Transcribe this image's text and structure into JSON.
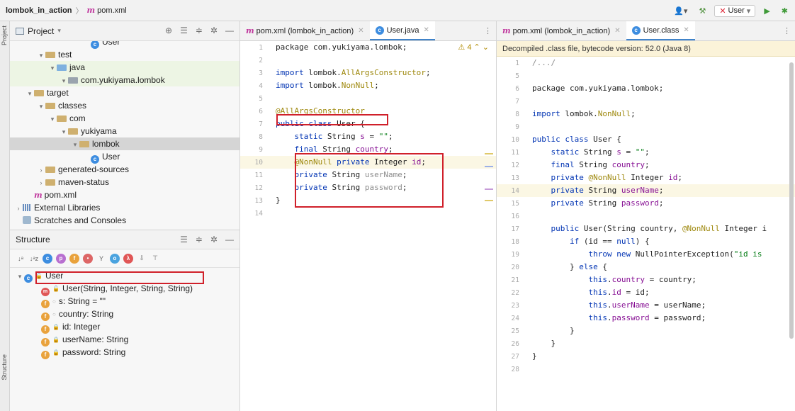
{
  "topbar": {
    "project": "lombok_in_action",
    "file": "pom.xml",
    "run_config": "User"
  },
  "stripe": {
    "top_label": "Project",
    "bottom_label": "Structure"
  },
  "project_panel": {
    "title": "Project",
    "tree": [
      {
        "label": "User",
        "type": "class",
        "indent": 5
      },
      {
        "label": "test",
        "type": "folder",
        "color": "yellow",
        "arrow": "open",
        "indent": 1
      },
      {
        "label": "java",
        "type": "folder",
        "color": "green",
        "arrow": "open",
        "indent": 2,
        "highlight": "green"
      },
      {
        "label": "com.yukiyama.lombok",
        "type": "folder",
        "color": "grey",
        "arrow": "open",
        "indent": 3,
        "highlight": "green"
      },
      {
        "label": "target",
        "type": "folder",
        "color": "yellow",
        "arrow": "open",
        "indent": 0
      },
      {
        "label": "classes",
        "type": "folder",
        "color": "yellow",
        "arrow": "open",
        "indent": 1
      },
      {
        "label": "com",
        "type": "folder",
        "color": "yellow",
        "arrow": "open",
        "indent": 2
      },
      {
        "label": "yukiyama",
        "type": "folder",
        "color": "yellow",
        "arrow": "open",
        "indent": 3
      },
      {
        "label": "lombok",
        "type": "folder",
        "color": "yellow",
        "arrow": "open",
        "indent": 4,
        "highlight": "selected"
      },
      {
        "label": "User",
        "type": "class",
        "indent": 5
      },
      {
        "label": "generated-sources",
        "type": "folder",
        "color": "yellow",
        "arrow": "closed",
        "indent": 1
      },
      {
        "label": "maven-status",
        "type": "folder",
        "color": "yellow",
        "arrow": "closed",
        "indent": 1
      },
      {
        "label": "pom.xml",
        "type": "maven",
        "indent": 0
      },
      {
        "label": "External Libraries",
        "type": "libs",
        "arrow": "closed",
        "indent": -1
      },
      {
        "label": "Scratches and Consoles",
        "type": "scratch",
        "indent": -1
      }
    ]
  },
  "structure_panel": {
    "title": "Structure",
    "root": "User",
    "members": [
      {
        "label": "User(String, Integer, String, String)",
        "kind": "method",
        "vis": "public"
      },
      {
        "label": "s: String = \"\"",
        "kind": "field",
        "vis": "package",
        "static": true
      },
      {
        "label": "country: String",
        "kind": "field",
        "vis": "package"
      },
      {
        "label": "id: Integer",
        "kind": "field",
        "vis": "private"
      },
      {
        "label": "userName: String",
        "kind": "field",
        "vis": "private"
      },
      {
        "label": "password: String",
        "kind": "field",
        "vis": "private"
      }
    ]
  },
  "editor_left": {
    "tabs": [
      {
        "label": "pom.xml (lombok_in_action)",
        "icon": "maven",
        "active": false
      },
      {
        "label": "User.java",
        "icon": "class",
        "active": true
      }
    ],
    "warnings": "4",
    "lines": [
      [
        {
          "t": "package com.yukiyama.lombok;",
          "c": ""
        }
      ],
      [],
      [
        {
          "t": "import ",
          "c": "kw"
        },
        {
          "t": "lombok.",
          "c": ""
        },
        {
          "t": "AllArgsConstructor",
          "c": "ann"
        },
        {
          "t": ";",
          "c": ""
        }
      ],
      [
        {
          "t": "import ",
          "c": "kw"
        },
        {
          "t": "lombok.",
          "c": ""
        },
        {
          "t": "NonNull",
          "c": "ann"
        },
        {
          "t": ";",
          "c": ""
        }
      ],
      [],
      [
        {
          "t": "@AllArgsConstructor",
          "c": "ann"
        }
      ],
      [
        {
          "t": "public class ",
          "c": "kw"
        },
        {
          "t": "User {",
          "c": ""
        }
      ],
      [
        {
          "t": "    ",
          "c": ""
        },
        {
          "t": "static ",
          "c": "kw"
        },
        {
          "t": "String ",
          "c": ""
        },
        {
          "t": "s",
          "c": "fld"
        },
        {
          "t": " = ",
          "c": ""
        },
        {
          "t": "\"\"",
          "c": "str"
        },
        {
          "t": ";",
          "c": ""
        }
      ],
      [
        {
          "t": "    ",
          "c": ""
        },
        {
          "t": "final ",
          "c": "kw"
        },
        {
          "t": "String ",
          "c": ""
        },
        {
          "t": "country",
          "c": "fld"
        },
        {
          "t": ";",
          "c": ""
        }
      ],
      [
        {
          "t": "    ",
          "c": ""
        },
        {
          "t": "@NonNull ",
          "c": "ann"
        },
        {
          "t": "private ",
          "c": "kw"
        },
        {
          "t": "Integer ",
          "c": ""
        },
        {
          "t": "id",
          "c": "fld"
        },
        {
          "t": ";",
          "c": ""
        }
      ],
      [
        {
          "t": "    ",
          "c": ""
        },
        {
          "t": "private ",
          "c": "kw"
        },
        {
          "t": "String ",
          "c": ""
        },
        {
          "t": "userName",
          "c": "grey"
        },
        {
          "t": ";",
          "c": ""
        }
      ],
      [
        {
          "t": "    ",
          "c": ""
        },
        {
          "t": "private ",
          "c": "kw"
        },
        {
          "t": "String ",
          "c": ""
        },
        {
          "t": "password",
          "c": "grey"
        },
        {
          "t": ";",
          "c": ""
        }
      ],
      [
        {
          "t": "}",
          "c": ""
        }
      ],
      []
    ]
  },
  "editor_right": {
    "tabs": [
      {
        "label": "pom.xml (lombok_in_action)",
        "icon": "maven",
        "active": false
      },
      {
        "label": "User.class",
        "icon": "class",
        "active": true
      }
    ],
    "banner": "Decompiled .class file, bytecode version: 52.0 (Java 8)",
    "line_numbers": [
      "1",
      "5",
      "6",
      "7",
      "8",
      "9",
      "10",
      "11",
      "12",
      "13",
      "14",
      "15",
      "16",
      "17",
      "18",
      "19",
      "20",
      "21",
      "22",
      "23",
      "24",
      "25",
      "26",
      "27",
      "28"
    ],
    "lines": [
      [
        {
          "t": "/.../",
          "c": "grey"
        }
      ],
      [],
      [
        {
          "t": "package com.yukiyama.lombok;",
          "c": ""
        }
      ],
      [],
      [
        {
          "t": "import ",
          "c": "kw"
        },
        {
          "t": "lombok.",
          "c": ""
        },
        {
          "t": "NonNull",
          "c": "ann"
        },
        {
          "t": ";",
          "c": ""
        }
      ],
      [],
      [
        {
          "t": "public class ",
          "c": "kw"
        },
        {
          "t": "User {",
          "c": ""
        }
      ],
      [
        {
          "t": "    ",
          "c": ""
        },
        {
          "t": "static ",
          "c": "kw"
        },
        {
          "t": "String ",
          "c": ""
        },
        {
          "t": "s",
          "c": "fld"
        },
        {
          "t": " = ",
          "c": ""
        },
        {
          "t": "\"\"",
          "c": "str"
        },
        {
          "t": ";",
          "c": ""
        }
      ],
      [
        {
          "t": "    ",
          "c": ""
        },
        {
          "t": "final ",
          "c": "kw"
        },
        {
          "t": "String ",
          "c": ""
        },
        {
          "t": "country",
          "c": "fld"
        },
        {
          "t": ";",
          "c": ""
        }
      ],
      [
        {
          "t": "    ",
          "c": ""
        },
        {
          "t": "private ",
          "c": "kw"
        },
        {
          "t": "@NonNull ",
          "c": "ann"
        },
        {
          "t": "Integer ",
          "c": ""
        },
        {
          "t": "id",
          "c": "fld"
        },
        {
          "t": ";",
          "c": ""
        }
      ],
      [
        {
          "t": "    ",
          "c": ""
        },
        {
          "t": "private ",
          "c": "kw"
        },
        {
          "t": "String ",
          "c": ""
        },
        {
          "t": "userName",
          "c": "fld"
        },
        {
          "t": ";",
          "c": ""
        }
      ],
      [
        {
          "t": "    ",
          "c": ""
        },
        {
          "t": "private ",
          "c": "kw"
        },
        {
          "t": "String ",
          "c": ""
        },
        {
          "t": "password",
          "c": "fld"
        },
        {
          "t": ";",
          "c": ""
        }
      ],
      [],
      [
        {
          "t": "    ",
          "c": ""
        },
        {
          "t": "public ",
          "c": "kw"
        },
        {
          "t": "User(String country, ",
          "c": ""
        },
        {
          "t": "@NonNull ",
          "c": "ann"
        },
        {
          "t": "Integer i",
          "c": ""
        }
      ],
      [
        {
          "t": "        ",
          "c": ""
        },
        {
          "t": "if ",
          "c": "kw"
        },
        {
          "t": "(id == ",
          "c": ""
        },
        {
          "t": "null",
          "c": "kw"
        },
        {
          "t": ") {",
          "c": ""
        }
      ],
      [
        {
          "t": "            ",
          "c": ""
        },
        {
          "t": "throw new ",
          "c": "kw"
        },
        {
          "t": "NullPointerException(",
          "c": ""
        },
        {
          "t": "\"id is",
          "c": "str"
        }
      ],
      [
        {
          "t": "        } ",
          "c": ""
        },
        {
          "t": "else ",
          "c": "kw"
        },
        {
          "t": "{",
          "c": ""
        }
      ],
      [
        {
          "t": "            ",
          "c": ""
        },
        {
          "t": "this",
          "c": "kw"
        },
        {
          "t": ".",
          "c": ""
        },
        {
          "t": "country",
          "c": "fld"
        },
        {
          "t": " = country;",
          "c": ""
        }
      ],
      [
        {
          "t": "            ",
          "c": ""
        },
        {
          "t": "this",
          "c": "kw"
        },
        {
          "t": ".",
          "c": ""
        },
        {
          "t": "id",
          "c": "fld"
        },
        {
          "t": " = id;",
          "c": ""
        }
      ],
      [
        {
          "t": "            ",
          "c": ""
        },
        {
          "t": "this",
          "c": "kw"
        },
        {
          "t": ".",
          "c": ""
        },
        {
          "t": "userName",
          "c": "fld"
        },
        {
          "t": " = userName;",
          "c": ""
        }
      ],
      [
        {
          "t": "            ",
          "c": ""
        },
        {
          "t": "this",
          "c": "kw"
        },
        {
          "t": ".",
          "c": ""
        },
        {
          "t": "password",
          "c": "fld"
        },
        {
          "t": " = password;",
          "c": ""
        }
      ],
      [
        {
          "t": "        }",
          "c": ""
        }
      ],
      [
        {
          "t": "    }",
          "c": ""
        }
      ],
      [
        {
          "t": "}",
          "c": ""
        }
      ],
      []
    ]
  },
  "colors": {
    "keyword": "#0033b3",
    "annotation": "#9e880d",
    "string": "#067d17",
    "field": "#871094",
    "annotation_box": "#d0202a"
  }
}
